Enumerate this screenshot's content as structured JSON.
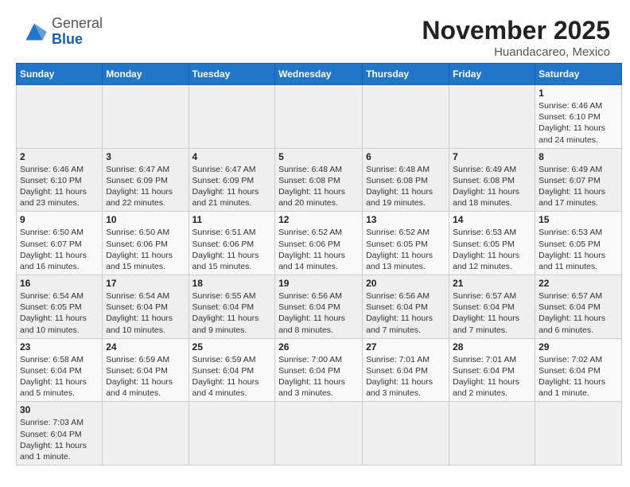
{
  "header": {
    "logo_general": "General",
    "logo_blue": "Blue",
    "month_title": "November 2025",
    "location": "Huandacareo, Mexico"
  },
  "days_of_week": [
    "Sunday",
    "Monday",
    "Tuesday",
    "Wednesday",
    "Thursday",
    "Friday",
    "Saturday"
  ],
  "weeks": [
    [
      {
        "day": "",
        "info": ""
      },
      {
        "day": "",
        "info": ""
      },
      {
        "day": "",
        "info": ""
      },
      {
        "day": "",
        "info": ""
      },
      {
        "day": "",
        "info": ""
      },
      {
        "day": "",
        "info": ""
      },
      {
        "day": "1",
        "info": "Sunrise: 6:46 AM\nSunset: 6:10 PM\nDaylight: 11 hours\nand 24 minutes."
      }
    ],
    [
      {
        "day": "2",
        "info": "Sunrise: 6:46 AM\nSunset: 6:10 PM\nDaylight: 11 hours\nand 23 minutes."
      },
      {
        "day": "3",
        "info": "Sunrise: 6:47 AM\nSunset: 6:09 PM\nDaylight: 11 hours\nand 22 minutes."
      },
      {
        "day": "4",
        "info": "Sunrise: 6:47 AM\nSunset: 6:09 PM\nDaylight: 11 hours\nand 21 minutes."
      },
      {
        "day": "5",
        "info": "Sunrise: 6:48 AM\nSunset: 6:08 PM\nDaylight: 11 hours\nand 20 minutes."
      },
      {
        "day": "6",
        "info": "Sunrise: 6:48 AM\nSunset: 6:08 PM\nDaylight: 11 hours\nand 19 minutes."
      },
      {
        "day": "7",
        "info": "Sunrise: 6:49 AM\nSunset: 6:08 PM\nDaylight: 11 hours\nand 18 minutes."
      },
      {
        "day": "8",
        "info": "Sunrise: 6:49 AM\nSunset: 6:07 PM\nDaylight: 11 hours\nand 17 minutes."
      }
    ],
    [
      {
        "day": "9",
        "info": "Sunrise: 6:50 AM\nSunset: 6:07 PM\nDaylight: 11 hours\nand 16 minutes."
      },
      {
        "day": "10",
        "info": "Sunrise: 6:50 AM\nSunset: 6:06 PM\nDaylight: 11 hours\nand 15 minutes."
      },
      {
        "day": "11",
        "info": "Sunrise: 6:51 AM\nSunset: 6:06 PM\nDaylight: 11 hours\nand 15 minutes."
      },
      {
        "day": "12",
        "info": "Sunrise: 6:52 AM\nSunset: 6:06 PM\nDaylight: 11 hours\nand 14 minutes."
      },
      {
        "day": "13",
        "info": "Sunrise: 6:52 AM\nSunset: 6:05 PM\nDaylight: 11 hours\nand 13 minutes."
      },
      {
        "day": "14",
        "info": "Sunrise: 6:53 AM\nSunset: 6:05 PM\nDaylight: 11 hours\nand 12 minutes."
      },
      {
        "day": "15",
        "info": "Sunrise: 6:53 AM\nSunset: 6:05 PM\nDaylight: 11 hours\nand 11 minutes."
      }
    ],
    [
      {
        "day": "16",
        "info": "Sunrise: 6:54 AM\nSunset: 6:05 PM\nDaylight: 11 hours\nand 10 minutes."
      },
      {
        "day": "17",
        "info": "Sunrise: 6:54 AM\nSunset: 6:04 PM\nDaylight: 11 hours\nand 10 minutes."
      },
      {
        "day": "18",
        "info": "Sunrise: 6:55 AM\nSunset: 6:04 PM\nDaylight: 11 hours\nand 9 minutes."
      },
      {
        "day": "19",
        "info": "Sunrise: 6:56 AM\nSunset: 6:04 PM\nDaylight: 11 hours\nand 8 minutes."
      },
      {
        "day": "20",
        "info": "Sunrise: 6:56 AM\nSunset: 6:04 PM\nDaylight: 11 hours\nand 7 minutes."
      },
      {
        "day": "21",
        "info": "Sunrise: 6:57 AM\nSunset: 6:04 PM\nDaylight: 11 hours\nand 7 minutes."
      },
      {
        "day": "22",
        "info": "Sunrise: 6:57 AM\nSunset: 6:04 PM\nDaylight: 11 hours\nand 6 minutes."
      }
    ],
    [
      {
        "day": "23",
        "info": "Sunrise: 6:58 AM\nSunset: 6:04 PM\nDaylight: 11 hours\nand 5 minutes."
      },
      {
        "day": "24",
        "info": "Sunrise: 6:59 AM\nSunset: 6:04 PM\nDaylight: 11 hours\nand 4 minutes."
      },
      {
        "day": "25",
        "info": "Sunrise: 6:59 AM\nSunset: 6:04 PM\nDaylight: 11 hours\nand 4 minutes."
      },
      {
        "day": "26",
        "info": "Sunrise: 7:00 AM\nSunset: 6:04 PM\nDaylight: 11 hours\nand 3 minutes."
      },
      {
        "day": "27",
        "info": "Sunrise: 7:01 AM\nSunset: 6:04 PM\nDaylight: 11 hours\nand 3 minutes."
      },
      {
        "day": "28",
        "info": "Sunrise: 7:01 AM\nSunset: 6:04 PM\nDaylight: 11 hours\nand 2 minutes."
      },
      {
        "day": "29",
        "info": "Sunrise: 7:02 AM\nSunset: 6:04 PM\nDaylight: 11 hours\nand 1 minute."
      }
    ],
    [
      {
        "day": "30",
        "info": "Sunrise: 7:03 AM\nSunset: 6:04 PM\nDaylight: 11 hours\nand 1 minute."
      },
      {
        "day": "",
        "info": ""
      },
      {
        "day": "",
        "info": ""
      },
      {
        "day": "",
        "info": ""
      },
      {
        "day": "",
        "info": ""
      },
      {
        "day": "",
        "info": ""
      },
      {
        "day": "",
        "info": ""
      }
    ]
  ]
}
